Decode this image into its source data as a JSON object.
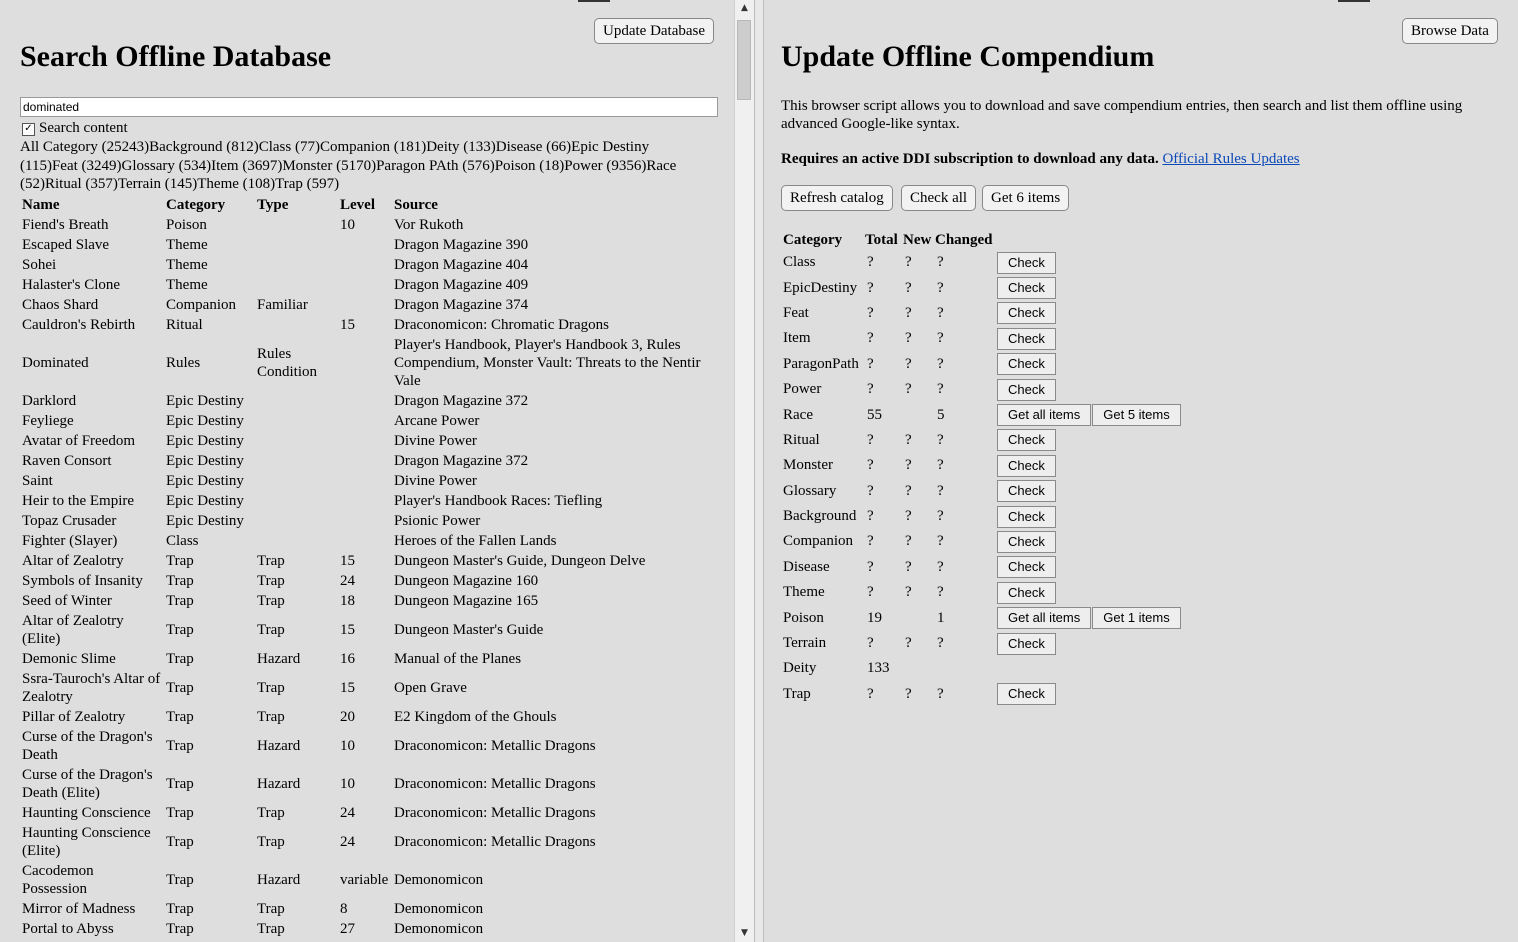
{
  "search": {
    "update_button": "Update Database",
    "title": "Search Offline Database",
    "query_value": "dominated",
    "search_content_label": "Search content",
    "search_content_checked": true,
    "categories": [
      "All Category (25243)",
      "Background (812)",
      "Class (77)",
      "Companion (181)",
      "Deity (133)",
      "Disease (66)",
      "Epic Destiny (115)",
      "Feat (3249)",
      "Glossary (534)",
      "Item (3697)",
      "Monster (5170)",
      "Paragon PAth (576)",
      "Poison (18)",
      "Power (9356)",
      "Race (52)",
      "Ritual (357)",
      "Terrain (145)",
      "Theme (108)",
      "Trap (597)"
    ],
    "columns": [
      "Name",
      "Category",
      "Type",
      "Level",
      "Source"
    ],
    "rows": [
      [
        "Fiend's Breath",
        "Poison",
        "",
        "10",
        "Vor Rukoth"
      ],
      [
        "Escaped Slave",
        "Theme",
        "",
        "",
        "Dragon Magazine 390"
      ],
      [
        "Sohei",
        "Theme",
        "",
        "",
        "Dragon Magazine 404"
      ],
      [
        "Halaster's Clone",
        "Theme",
        "",
        "",
        "Dragon Magazine 409"
      ],
      [
        "Chaos Shard",
        "Companion",
        "Familiar",
        "",
        "Dragon Magazine 374"
      ],
      [
        "Cauldron's Rebirth",
        "Ritual",
        "",
        "15",
        "Draconomicon: Chromatic Dragons"
      ],
      [
        "Dominated",
        "Rules",
        "Rules Condition",
        "",
        "Player's Handbook, Player's Handbook 3, Rules Compendium, Monster Vault: Threats to the Nentir Vale"
      ],
      [
        "Darklord",
        "Epic Destiny",
        "",
        "",
        "Dragon Magazine 372"
      ],
      [
        "Feyliege",
        "Epic Destiny",
        "",
        "",
        "Arcane Power"
      ],
      [
        "Avatar of Freedom",
        "Epic Destiny",
        "",
        "",
        "Divine Power"
      ],
      [
        "Raven Consort",
        "Epic Destiny",
        "",
        "",
        "Dragon Magazine 372"
      ],
      [
        "Saint",
        "Epic Destiny",
        "",
        "",
        "Divine Power"
      ],
      [
        "Heir to the Empire",
        "Epic Destiny",
        "",
        "",
        "Player's Handbook Races: Tiefling"
      ],
      [
        "Topaz Crusader",
        "Epic Destiny",
        "",
        "",
        "Psionic Power"
      ],
      [
        "Fighter (Slayer)",
        "Class",
        "",
        "",
        "Heroes of the Fallen Lands"
      ],
      [
        "Altar of Zealotry",
        "Trap",
        "Trap",
        "15",
        "Dungeon Master's Guide, Dungeon Delve"
      ],
      [
        "Symbols of Insanity",
        "Trap",
        "Trap",
        "24",
        "Dungeon Magazine 160"
      ],
      [
        "Seed of Winter",
        "Trap",
        "Trap",
        "18",
        "Dungeon Magazine 165"
      ],
      [
        "Altar of Zealotry (Elite)",
        "Trap",
        "Trap",
        "15",
        "Dungeon Master's Guide"
      ],
      [
        "Demonic Slime",
        "Trap",
        "Hazard",
        "16",
        "Manual of the Planes"
      ],
      [
        "Ssra-Tauroch's Altar of Zealotry",
        "Trap",
        "Trap",
        "15",
        "Open Grave"
      ],
      [
        "Pillar of Zealotry",
        "Trap",
        "Trap",
        "20",
        "E2 Kingdom of the Ghouls"
      ],
      [
        "Curse of the Dragon's Death",
        "Trap",
        "Hazard",
        "10",
        "Draconomicon: Metallic Dragons"
      ],
      [
        "Curse of the Dragon's Death (Elite)",
        "Trap",
        "Hazard",
        "10",
        "Draconomicon: Metallic Dragons"
      ],
      [
        "Haunting Conscience",
        "Trap",
        "Trap",
        "24",
        "Draconomicon: Metallic Dragons"
      ],
      [
        "Haunting Conscience (Elite)",
        "Trap",
        "Trap",
        "24",
        "Draconomicon: Metallic Dragons"
      ],
      [
        "Cacodemon Possession",
        "Trap",
        "Hazard",
        "variable",
        "Demonomicon"
      ],
      [
        "Mirror of Madness",
        "Trap",
        "Trap",
        "8",
        "Demonomicon"
      ],
      [
        "Portal to Abyss",
        "Trap",
        "Trap",
        "27",
        "Demonomicon"
      ]
    ]
  },
  "update": {
    "browse_button": "Browse Data",
    "title": "Update Offline Compendium",
    "intro": "This browser script allows you to download and save compendium entries, then search and list them offline using advanced Google-like syntax.",
    "requires": "Requires an active DDI subscription to download any data.",
    "link": "Official Rules Updates",
    "refresh_button": "Refresh catalog",
    "checkall_button": "Check all",
    "get_button": "Get 6 items",
    "columns": [
      "Category",
      "Total",
      "New",
      "Changed"
    ],
    "rows": [
      {
        "category": "Class",
        "total": "?",
        "new": "?",
        "changed": "?",
        "actions": [
          "Check"
        ]
      },
      {
        "category": "EpicDestiny",
        "total": "?",
        "new": "?",
        "changed": "?",
        "actions": [
          "Check"
        ]
      },
      {
        "category": "Feat",
        "total": "?",
        "new": "?",
        "changed": "?",
        "actions": [
          "Check"
        ]
      },
      {
        "category": "Item",
        "total": "?",
        "new": "?",
        "changed": "?",
        "actions": [
          "Check"
        ]
      },
      {
        "category": "ParagonPath",
        "total": "?",
        "new": "?",
        "changed": "?",
        "actions": [
          "Check"
        ]
      },
      {
        "category": "Power",
        "total": "?",
        "new": "?",
        "changed": "?",
        "actions": [
          "Check"
        ]
      },
      {
        "category": "Race",
        "total": "55",
        "new": "",
        "changed": "5",
        "actions": [
          "Get all items",
          "Get 5 items"
        ]
      },
      {
        "category": "Ritual",
        "total": "?",
        "new": "?",
        "changed": "?",
        "actions": [
          "Check"
        ]
      },
      {
        "category": "Monster",
        "total": "?",
        "new": "?",
        "changed": "?",
        "actions": [
          "Check"
        ]
      },
      {
        "category": "Glossary",
        "total": "?",
        "new": "?",
        "changed": "?",
        "actions": [
          "Check"
        ]
      },
      {
        "category": "Background",
        "total": "?",
        "new": "?",
        "changed": "?",
        "actions": [
          "Check"
        ]
      },
      {
        "category": "Companion",
        "total": "?",
        "new": "?",
        "changed": "?",
        "actions": [
          "Check"
        ]
      },
      {
        "category": "Disease",
        "total": "?",
        "new": "?",
        "changed": "?",
        "actions": [
          "Check"
        ]
      },
      {
        "category": "Theme",
        "total": "?",
        "new": "?",
        "changed": "?",
        "actions": [
          "Check"
        ]
      },
      {
        "category": "Poison",
        "total": "19",
        "new": "",
        "changed": "1",
        "actions": [
          "Get all items",
          "Get 1 items"
        ]
      },
      {
        "category": "Terrain",
        "total": "?",
        "new": "?",
        "changed": "?",
        "actions": [
          "Check"
        ]
      },
      {
        "category": "Deity",
        "total": "133",
        "new": "",
        "changed": "",
        "actions": []
      },
      {
        "category": "Trap",
        "total": "?",
        "new": "?",
        "changed": "?",
        "actions": [
          "Check"
        ]
      }
    ]
  }
}
